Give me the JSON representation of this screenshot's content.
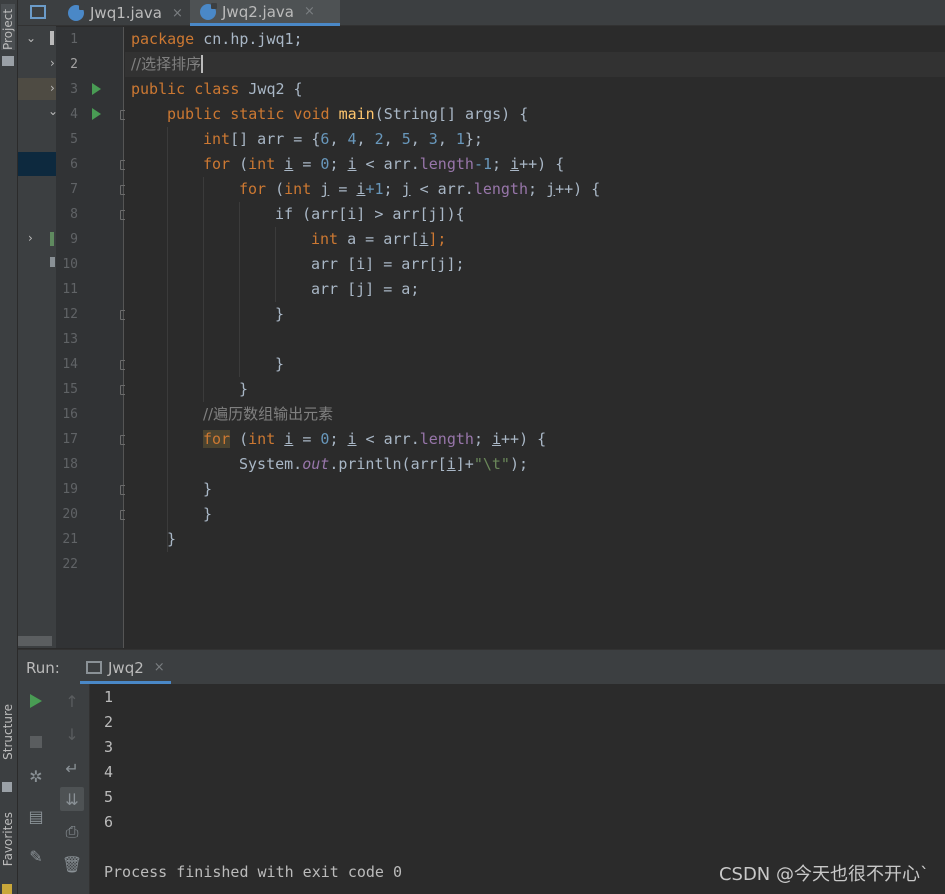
{
  "left_strip": {
    "project": "Project",
    "structure": "Structure",
    "favorites": "Favorites"
  },
  "tabs": [
    {
      "label": "Jwq1.java",
      "close": "×"
    },
    {
      "label": "Jwq2.java",
      "close": "×",
      "active": true
    }
  ],
  "gutter": {
    "line_numbers": [
      "1",
      "2",
      "3",
      "4",
      "5",
      "6",
      "7",
      "8",
      "9",
      "10",
      "11",
      "12",
      "13",
      "14",
      "15",
      "16",
      "17",
      "18",
      "19",
      "20",
      "21",
      "22"
    ],
    "current_line": "2"
  },
  "code": {
    "l1_kw": "package",
    "l1_rest": " cn.hp.jwq1;",
    "l2": "//选择排序",
    "l3_kw": "public class",
    "l3_rest": " Jwq2 {",
    "l4_kw": "public static void",
    "l4_fn": "main",
    "l4_rest": "(String[] args) {",
    "l5_kw": "int",
    "l5_a": "[] arr = {",
    "l5_nums": [
      "6",
      "4",
      "2",
      "5",
      "3",
      "1"
    ],
    "l5_end": "};",
    "l6": {
      "kw": "for",
      "int": "int",
      "var": "i",
      "zero": "0",
      "cond": "arr.",
      "field": "length",
      "minus": "-1",
      "inc": "++) {"
    },
    "l7": {
      "kw": "for",
      "int": "int",
      "var": "j",
      "init": "i",
      "one": "+1",
      "field": "length",
      "inc": "++) {"
    },
    "l8": "if (arr[i] > arr[j]){",
    "l9_kw": "int",
    "l9_rest": " a = arr[",
    "l9_var": "i",
    "l9_end": "];",
    "l10": "arr [i] = arr[j];",
    "l11": "arr [j] = a;",
    "l12": "}",
    "l14": "}",
    "l15": "}",
    "l16": "//遍历数组输出元素",
    "l17": {
      "kw": "for",
      "int": "int",
      "var": "i",
      "zero": "0",
      "field": "length",
      "inc": "++) {"
    },
    "l18_a": "System.",
    "l18_out": "out",
    "l18_b": ".println(arr[",
    "l18_var": "i",
    "l18_c": "]+",
    "l18_str": "\"\\t\"",
    "l18_d": ");",
    "l19": "}",
    "l20": "}",
    "l21": "}"
  },
  "run": {
    "label": "Run:",
    "tab": "Jwq2",
    "close": "×",
    "output": [
      "1",
      "2",
      "3",
      "4",
      "5",
      "6"
    ],
    "exit": "Process finished with exit code 0"
  },
  "watermark": "CSDN @今天也很不开心`",
  "colors": {
    "keyword": "#cc7832",
    "number": "#6897bb",
    "string": "#6a8759",
    "function": "#ffc66d",
    "comment": "#808080",
    "field": "#9876aa",
    "accent": "#4a88c7",
    "run_green": "#499c54"
  }
}
